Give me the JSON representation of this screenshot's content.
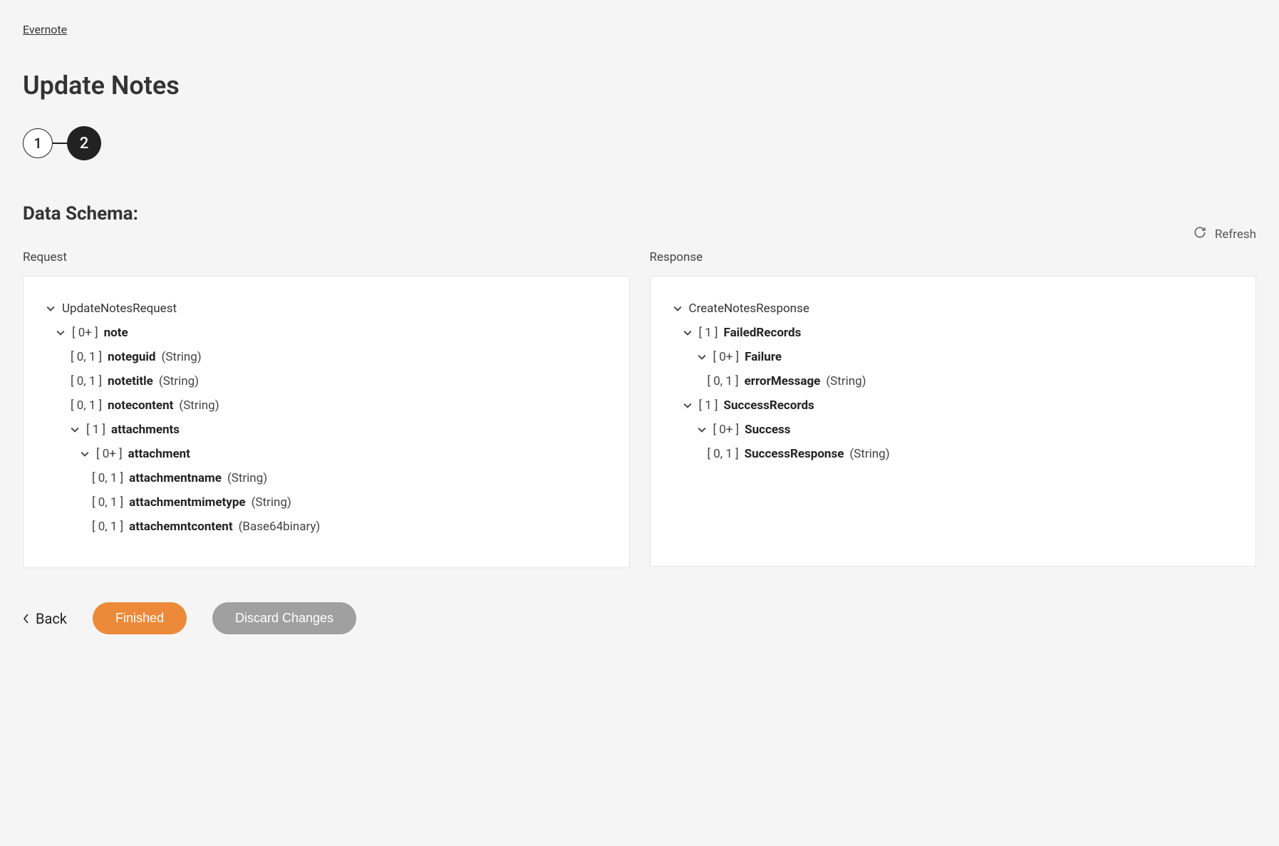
{
  "breadcrumb": {
    "parent": "Evernote"
  },
  "page": {
    "title": "Update Notes"
  },
  "stepper": {
    "step1": "1",
    "step2": "2"
  },
  "section": {
    "title": "Data Schema:"
  },
  "refresh": {
    "label": "Refresh"
  },
  "request": {
    "label": "Request",
    "root": "UpdateNotesRequest",
    "note": {
      "card": "[ 0+ ]",
      "name": "note"
    },
    "noteguid": {
      "card": "[ 0, 1 ]",
      "name": "noteguid",
      "type": "(String)"
    },
    "notetitle": {
      "card": "[ 0, 1 ]",
      "name": "notetitle",
      "type": "(String)"
    },
    "notecontent": {
      "card": "[ 0, 1 ]",
      "name": "notecontent",
      "type": "(String)"
    },
    "attachments": {
      "card": "[ 1 ]",
      "name": "attachments"
    },
    "attachment": {
      "card": "[ 0+ ]",
      "name": "attachment"
    },
    "attachmentname": {
      "card": "[ 0, 1 ]",
      "name": "attachmentname",
      "type": "(String)"
    },
    "attachmentmimetype": {
      "card": "[ 0, 1 ]",
      "name": "attachmentmimetype",
      "type": "(String)"
    },
    "attachemntcontent": {
      "card": "[ 0, 1 ]",
      "name": "attachemntcontent",
      "type": "(Base64binary)"
    }
  },
  "response": {
    "label": "Response",
    "root": "CreateNotesResponse",
    "failedrecords": {
      "card": "[ 1 ]",
      "name": "FailedRecords"
    },
    "failure": {
      "card": "[ 0+ ]",
      "name": "Failure"
    },
    "errormessage": {
      "card": "[ 0, 1 ]",
      "name": "errorMessage",
      "type": "(String)"
    },
    "successrecords": {
      "card": "[ 1 ]",
      "name": "SuccessRecords"
    },
    "success": {
      "card": "[ 0+ ]",
      "name": "Success"
    },
    "successresponse": {
      "card": "[ 0, 1 ]",
      "name": "SuccessResponse",
      "type": "(String)"
    }
  },
  "actions": {
    "back": "Back",
    "finished": "Finished",
    "discard": "Discard Changes"
  }
}
